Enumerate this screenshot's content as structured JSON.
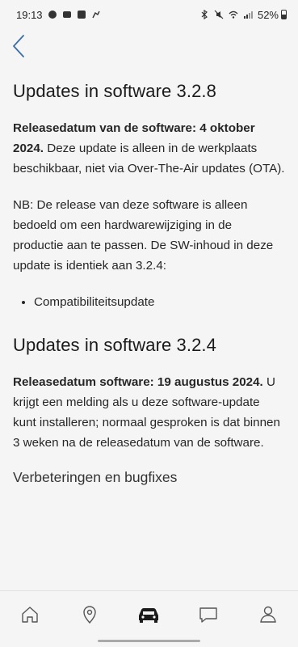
{
  "status_bar": {
    "time": "19:13",
    "battery": "52%",
    "icons_left": [
      "whatsapp-icon",
      "chat-icon",
      "media-icon",
      "cat-icon"
    ],
    "icons_right": [
      "bluetooth-icon",
      "mute-icon",
      "wifi-icon",
      "signal-icon",
      "battery-icon"
    ]
  },
  "section1": {
    "title": "Updates in software 3.2.8",
    "p1_bold": "Releasedatum van de software: 4 oktober 2024.",
    "p1_rest": " Deze update is alleen in de werkplaats beschikbaar, niet via Over-The-Air updates (OTA).",
    "p2": "NB: De release van deze software is alleen bedoeld om een hardwarewijziging in de productie aan te passen. De SW-inhoud in deze update is identiek aan 3.2.4:",
    "bullets": [
      "Compatibiliteitsupdate"
    ]
  },
  "section2": {
    "title": "Updates in software 3.2.4",
    "p1_bold": "Releasedatum software: 19 augustus 2024.",
    "p1_rest": " U krijgt een melding als u deze software-update kunt installeren; normaal gesproken is dat binnen 3 weken na de releasedatum van de software.",
    "subheading": "Verbeteringen en bugfixes"
  },
  "bottom_nav": {
    "items": [
      "home-icon",
      "location-pin-icon",
      "car-icon",
      "message-icon",
      "profile-icon"
    ],
    "active_index": 2
  },
  "colors": {
    "accent": "#2f5d8a",
    "background": "#f5f5f5",
    "text": "#1b1b1b"
  }
}
